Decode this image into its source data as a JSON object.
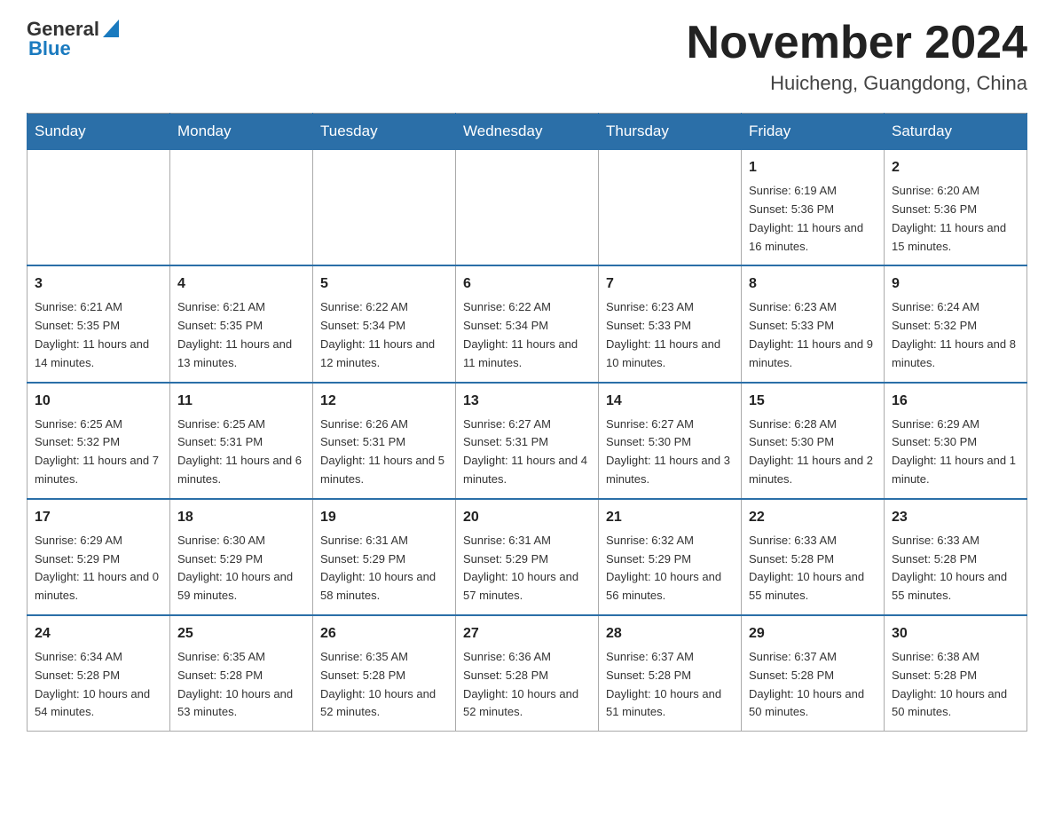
{
  "header": {
    "logo": {
      "general": "General",
      "blue": "Blue"
    },
    "title": "November 2024",
    "location": "Huicheng, Guangdong, China"
  },
  "days_of_week": [
    "Sunday",
    "Monday",
    "Tuesday",
    "Wednesday",
    "Thursday",
    "Friday",
    "Saturday"
  ],
  "weeks": [
    {
      "days": [
        {
          "date": "",
          "info": ""
        },
        {
          "date": "",
          "info": ""
        },
        {
          "date": "",
          "info": ""
        },
        {
          "date": "",
          "info": ""
        },
        {
          "date": "",
          "info": ""
        },
        {
          "date": "1",
          "info": "Sunrise: 6:19 AM\nSunset: 5:36 PM\nDaylight: 11 hours and 16 minutes."
        },
        {
          "date": "2",
          "info": "Sunrise: 6:20 AM\nSunset: 5:36 PM\nDaylight: 11 hours and 15 minutes."
        }
      ]
    },
    {
      "days": [
        {
          "date": "3",
          "info": "Sunrise: 6:21 AM\nSunset: 5:35 PM\nDaylight: 11 hours and 14 minutes."
        },
        {
          "date": "4",
          "info": "Sunrise: 6:21 AM\nSunset: 5:35 PM\nDaylight: 11 hours and 13 minutes."
        },
        {
          "date": "5",
          "info": "Sunrise: 6:22 AM\nSunset: 5:34 PM\nDaylight: 11 hours and 12 minutes."
        },
        {
          "date": "6",
          "info": "Sunrise: 6:22 AM\nSunset: 5:34 PM\nDaylight: 11 hours and 11 minutes."
        },
        {
          "date": "7",
          "info": "Sunrise: 6:23 AM\nSunset: 5:33 PM\nDaylight: 11 hours and 10 minutes."
        },
        {
          "date": "8",
          "info": "Sunrise: 6:23 AM\nSunset: 5:33 PM\nDaylight: 11 hours and 9 minutes."
        },
        {
          "date": "9",
          "info": "Sunrise: 6:24 AM\nSunset: 5:32 PM\nDaylight: 11 hours and 8 minutes."
        }
      ]
    },
    {
      "days": [
        {
          "date": "10",
          "info": "Sunrise: 6:25 AM\nSunset: 5:32 PM\nDaylight: 11 hours and 7 minutes."
        },
        {
          "date": "11",
          "info": "Sunrise: 6:25 AM\nSunset: 5:31 PM\nDaylight: 11 hours and 6 minutes."
        },
        {
          "date": "12",
          "info": "Sunrise: 6:26 AM\nSunset: 5:31 PM\nDaylight: 11 hours and 5 minutes."
        },
        {
          "date": "13",
          "info": "Sunrise: 6:27 AM\nSunset: 5:31 PM\nDaylight: 11 hours and 4 minutes."
        },
        {
          "date": "14",
          "info": "Sunrise: 6:27 AM\nSunset: 5:30 PM\nDaylight: 11 hours and 3 minutes."
        },
        {
          "date": "15",
          "info": "Sunrise: 6:28 AM\nSunset: 5:30 PM\nDaylight: 11 hours and 2 minutes."
        },
        {
          "date": "16",
          "info": "Sunrise: 6:29 AM\nSunset: 5:30 PM\nDaylight: 11 hours and 1 minute."
        }
      ]
    },
    {
      "days": [
        {
          "date": "17",
          "info": "Sunrise: 6:29 AM\nSunset: 5:29 PM\nDaylight: 11 hours and 0 minutes."
        },
        {
          "date": "18",
          "info": "Sunrise: 6:30 AM\nSunset: 5:29 PM\nDaylight: 10 hours and 59 minutes."
        },
        {
          "date": "19",
          "info": "Sunrise: 6:31 AM\nSunset: 5:29 PM\nDaylight: 10 hours and 58 minutes."
        },
        {
          "date": "20",
          "info": "Sunrise: 6:31 AM\nSunset: 5:29 PM\nDaylight: 10 hours and 57 minutes."
        },
        {
          "date": "21",
          "info": "Sunrise: 6:32 AM\nSunset: 5:29 PM\nDaylight: 10 hours and 56 minutes."
        },
        {
          "date": "22",
          "info": "Sunrise: 6:33 AM\nSunset: 5:28 PM\nDaylight: 10 hours and 55 minutes."
        },
        {
          "date": "23",
          "info": "Sunrise: 6:33 AM\nSunset: 5:28 PM\nDaylight: 10 hours and 55 minutes."
        }
      ]
    },
    {
      "days": [
        {
          "date": "24",
          "info": "Sunrise: 6:34 AM\nSunset: 5:28 PM\nDaylight: 10 hours and 54 minutes."
        },
        {
          "date": "25",
          "info": "Sunrise: 6:35 AM\nSunset: 5:28 PM\nDaylight: 10 hours and 53 minutes."
        },
        {
          "date": "26",
          "info": "Sunrise: 6:35 AM\nSunset: 5:28 PM\nDaylight: 10 hours and 52 minutes."
        },
        {
          "date": "27",
          "info": "Sunrise: 6:36 AM\nSunset: 5:28 PM\nDaylight: 10 hours and 52 minutes."
        },
        {
          "date": "28",
          "info": "Sunrise: 6:37 AM\nSunset: 5:28 PM\nDaylight: 10 hours and 51 minutes."
        },
        {
          "date": "29",
          "info": "Sunrise: 6:37 AM\nSunset: 5:28 PM\nDaylight: 10 hours and 50 minutes."
        },
        {
          "date": "30",
          "info": "Sunrise: 6:38 AM\nSunset: 5:28 PM\nDaylight: 10 hours and 50 minutes."
        }
      ]
    }
  ]
}
